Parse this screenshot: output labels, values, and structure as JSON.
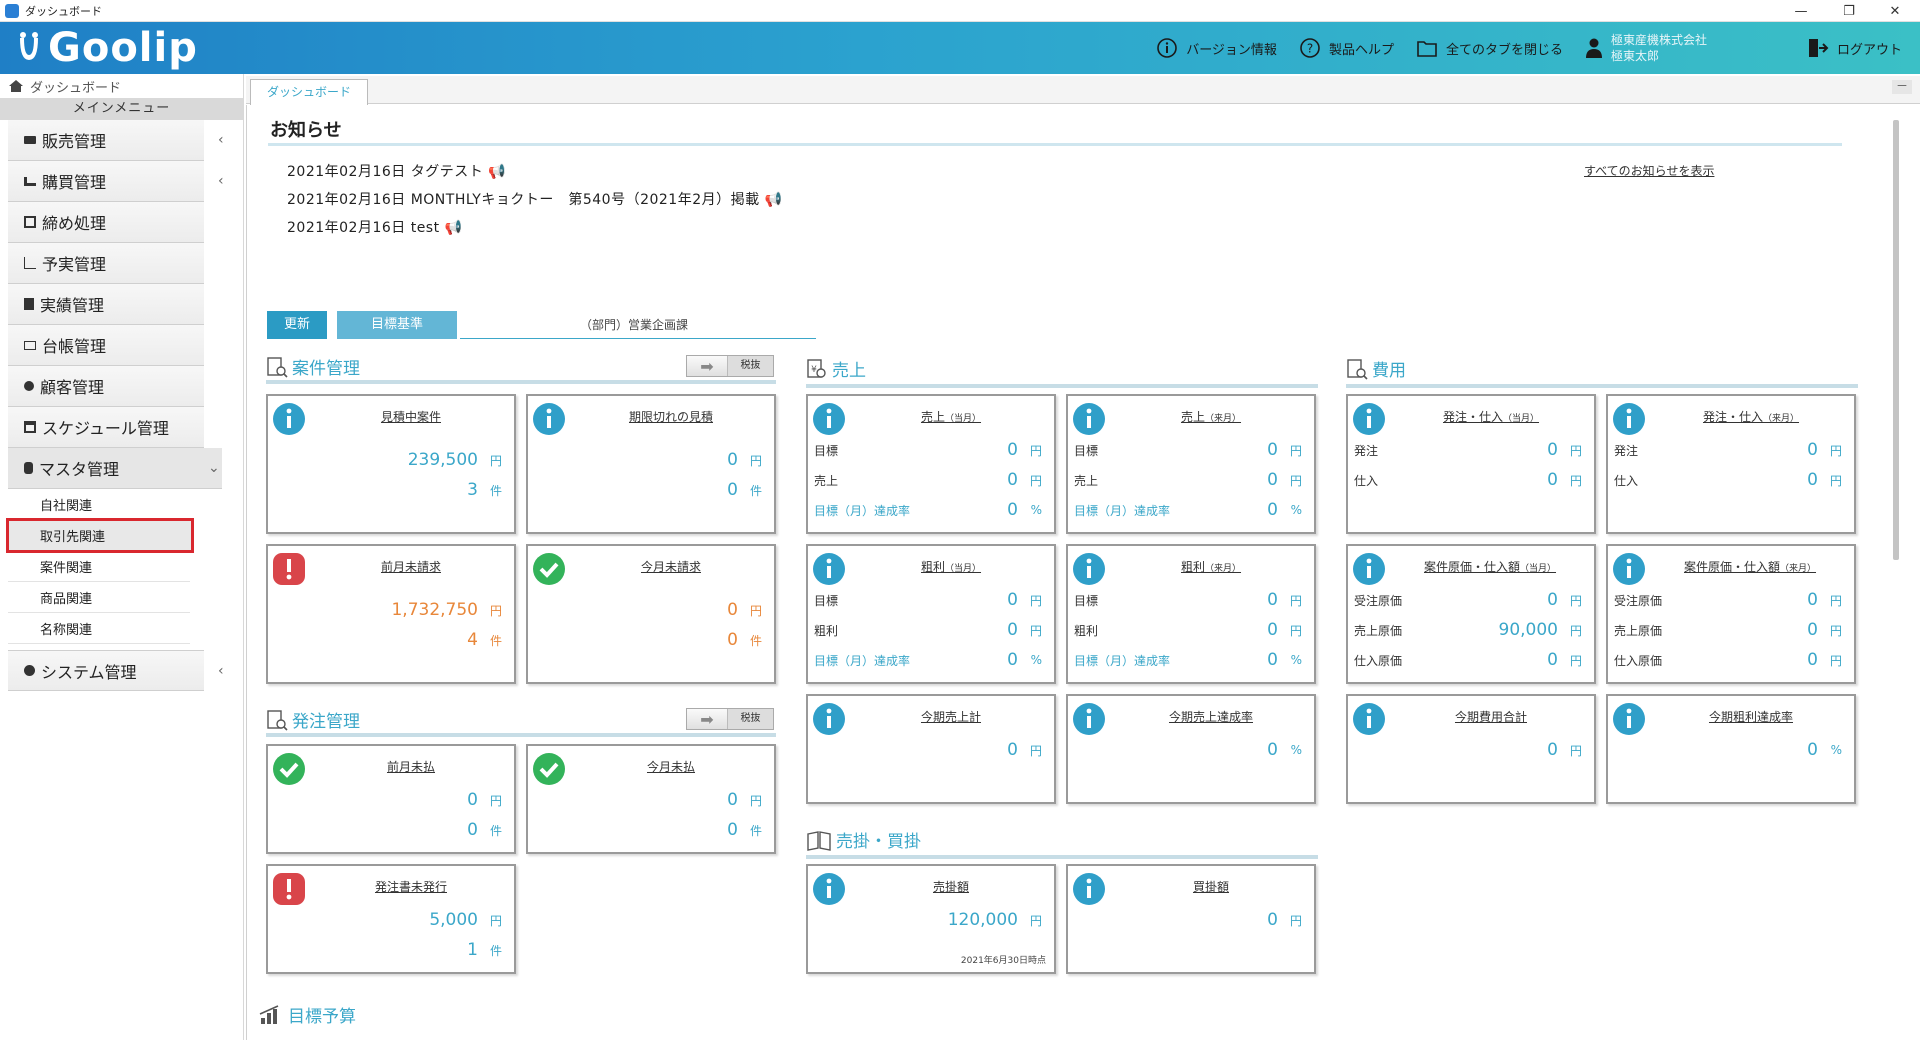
{
  "window": {
    "title": "ダッシュボード",
    "min": "—",
    "max": "❐",
    "close": "✕"
  },
  "header": {
    "logo_text": "Goolip",
    "version": "バージョン情報",
    "help": "製品ヘルプ",
    "close_tabs": "全てのタブを閉じる",
    "company": "極東産機株式会社",
    "user": "極東太郎",
    "logout": "ログアウト"
  },
  "sidebar": {
    "dashboard": "ダッシュボード",
    "main_menu": "メインメニュー",
    "items": [
      {
        "label": "販売管理",
        "chev": "‹"
      },
      {
        "label": "購買管理",
        "chev": "‹"
      },
      {
        "label": "締め処理",
        "chev": ""
      },
      {
        "label": "予実管理",
        "chev": ""
      },
      {
        "label": "実績管理",
        "chev": ""
      },
      {
        "label": "台帳管理",
        "chev": ""
      },
      {
        "label": "顧客管理",
        "chev": ""
      },
      {
        "label": "スケジュール管理",
        "chev": ""
      },
      {
        "label": "マスタ管理",
        "chev": "⌄"
      }
    ],
    "sub_items": [
      "自社関連",
      "取引先関連",
      "案件関連",
      "商品関連",
      "名称関連"
    ],
    "system": {
      "label": "システム管理",
      "chev": "‹"
    }
  },
  "tabs": {
    "active": "ダッシュボード",
    "minimize": "－"
  },
  "news": {
    "title": "お知らせ",
    "items": [
      "2021年02月16日 タグテスト",
      "2021年02月16日 MONTHLYキョクトー　第540号（2021年2月）掲載",
      "2021年02月16日 test"
    ],
    "show_all": "すべてのお知らせを表示"
  },
  "controls": {
    "refresh": "更新",
    "target_basis": "目標基準",
    "department": "（部門）営業企画課"
  },
  "tax_button": {
    "label": "税抜"
  },
  "sections": {
    "projects": "案件管理",
    "orders": "発注管理",
    "sales": "売上",
    "expenses": "費用",
    "receivables": "売掛・買掛",
    "budget": "目標予算"
  },
  "cards": {
    "p1": {
      "title": "見積中案件",
      "v1": "239,500",
      "u1": "円",
      "v2": "3",
      "u2": "件"
    },
    "p2": {
      "title": "期限切れの見積",
      "v1": "0",
      "u1": "円",
      "v2": "0",
      "u2": "件"
    },
    "p3": {
      "title": "前月未請求",
      "v1": "1,732,750",
      "u1": "円",
      "v2": "4",
      "u2": "件"
    },
    "p4": {
      "title": "今月未請求",
      "v1": "0",
      "u1": "円",
      "v2": "0",
      "u2": "件"
    },
    "o1": {
      "title": "前月未払",
      "v1": "0",
      "u1": "円",
      "v2": "0",
      "u2": "件"
    },
    "o2": {
      "title": "今月未払",
      "v1": "0",
      "u1": "円",
      "v2": "0",
      "u2": "件"
    },
    "o3": {
      "title": "発注書未発行",
      "v1": "5,000",
      "u1": "円",
      "v2": "1",
      "u2": "件"
    },
    "s1": {
      "title": "売上",
      "sub": "（当月）",
      "l1": "目標",
      "v1": "0",
      "u1": "円",
      "l2": "売上",
      "v2": "0",
      "u2": "円",
      "l3": "目標（月）達成率",
      "v3": "0",
      "u3": "%"
    },
    "s2": {
      "title": "売上",
      "sub": "（来月）",
      "l1": "目標",
      "v1": "0",
      "u1": "円",
      "l2": "売上",
      "v2": "0",
      "u2": "円",
      "l3": "目標（月）達成率",
      "v3": "0",
      "u3": "%"
    },
    "s3": {
      "title": "粗利",
      "sub": "（当月）",
      "l1": "目標",
      "v1": "0",
      "u1": "円",
      "l2": "粗利",
      "v2": "0",
      "u2": "円",
      "l3": "目標（月）達成率",
      "v3": "0",
      "u3": "%"
    },
    "s4": {
      "title": "粗利",
      "sub": "（来月）",
      "l1": "目標",
      "v1": "0",
      "u1": "円",
      "l2": "粗利",
      "v2": "0",
      "u2": "円",
      "l3": "目標（月）達成率",
      "v3": "0",
      "u3": "%"
    },
    "s5": {
      "title": "今期売上計",
      "v1": "0",
      "u1": "円"
    },
    "s6": {
      "title": "今期売上達成率",
      "v1": "0",
      "u1": "%"
    },
    "e1": {
      "title": "発注・仕入",
      "sub": "（当月）",
      "l1": "発注",
      "v1": "0",
      "u1": "円",
      "l2": "仕入",
      "v2": "0",
      "u2": "円"
    },
    "e2": {
      "title": "発注・仕入",
      "sub": "（来月）",
      "l1": "発注",
      "v1": "0",
      "u1": "円",
      "l2": "仕入",
      "v2": "0",
      "u2": "円"
    },
    "e3": {
      "title": "案件原価・仕入額",
      "sub": "（当月）",
      "l1": "受注原価",
      "v1": "0",
      "u1": "円",
      "l2": "売上原価",
      "v2": "90,000",
      "u2": "円",
      "l3": "仕入原価",
      "v3": "0",
      "u3": "円"
    },
    "e4": {
      "title": "案件原価・仕入額",
      "sub": "（来月）",
      "l1": "受注原価",
      "v1": "0",
      "u1": "円",
      "l2": "売上原価",
      "v2": "0",
      "u2": "円",
      "l3": "仕入原価",
      "v3": "0",
      "u3": "円"
    },
    "e5": {
      "title": "今期費用合計",
      "v1": "0",
      "u1": "円"
    },
    "e6": {
      "title": "今期粗利達成率",
      "v1": "0",
      "u1": "%"
    },
    "r1": {
      "title": "売掛額",
      "v1": "120,000",
      "u1": "円",
      "note": "2021年6月30日時点"
    },
    "r2": {
      "title": "買掛額",
      "v1": "0",
      "u1": "円"
    }
  },
  "colors": {
    "accent": "#3ba7c9",
    "orange": "#e8873a",
    "alert": "#d9454a",
    "ok": "#33b35a"
  }
}
